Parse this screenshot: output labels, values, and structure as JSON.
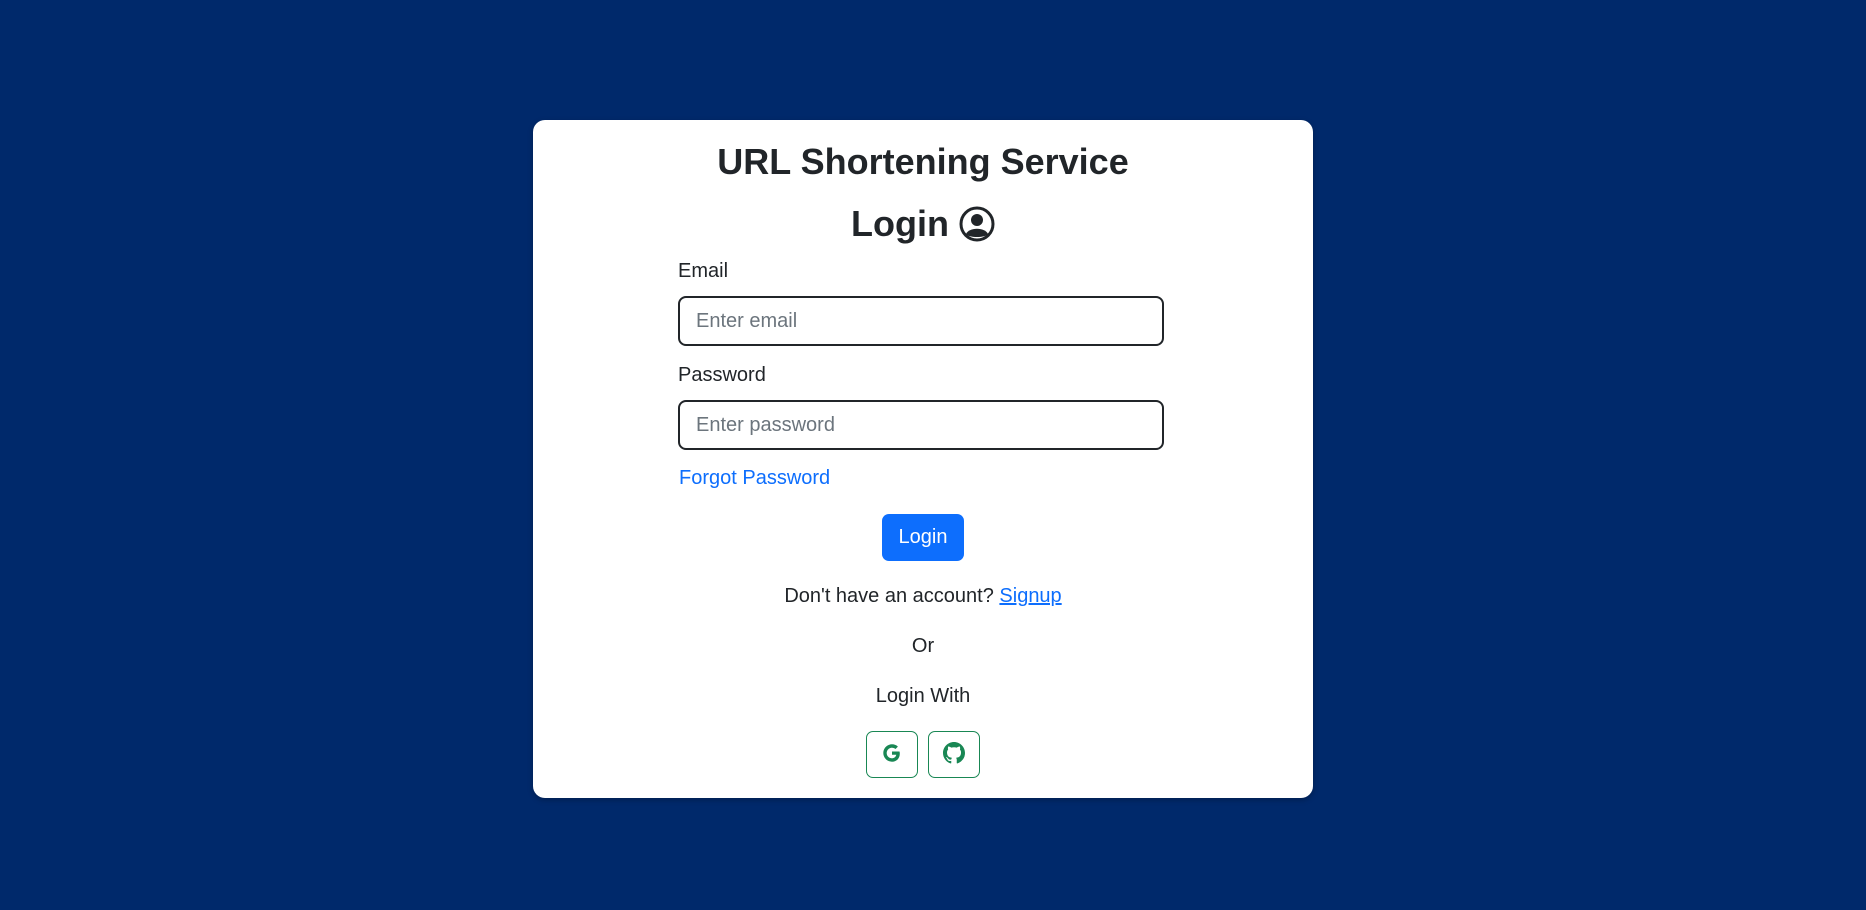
{
  "app": {
    "title": "URL Shortening Service"
  },
  "login": {
    "heading": "Login",
    "heading_icon": "user-circle-icon"
  },
  "email": {
    "label": "Email",
    "placeholder": "Enter email",
    "value": ""
  },
  "password": {
    "label": "Password",
    "placeholder": "Enter password",
    "value": ""
  },
  "links": {
    "forgot_password": "Forgot Password",
    "no_account_text": "Don't have an account?",
    "signup": "Signup"
  },
  "buttons": {
    "login": "Login"
  },
  "alt_login": {
    "or_text": "Or",
    "login_with": "Login With",
    "providers": [
      {
        "name": "google-icon"
      },
      {
        "name": "github-icon"
      }
    ]
  },
  "colors": {
    "background": "#00296b",
    "primary": "#0d6efd",
    "social_border": "#198754"
  }
}
